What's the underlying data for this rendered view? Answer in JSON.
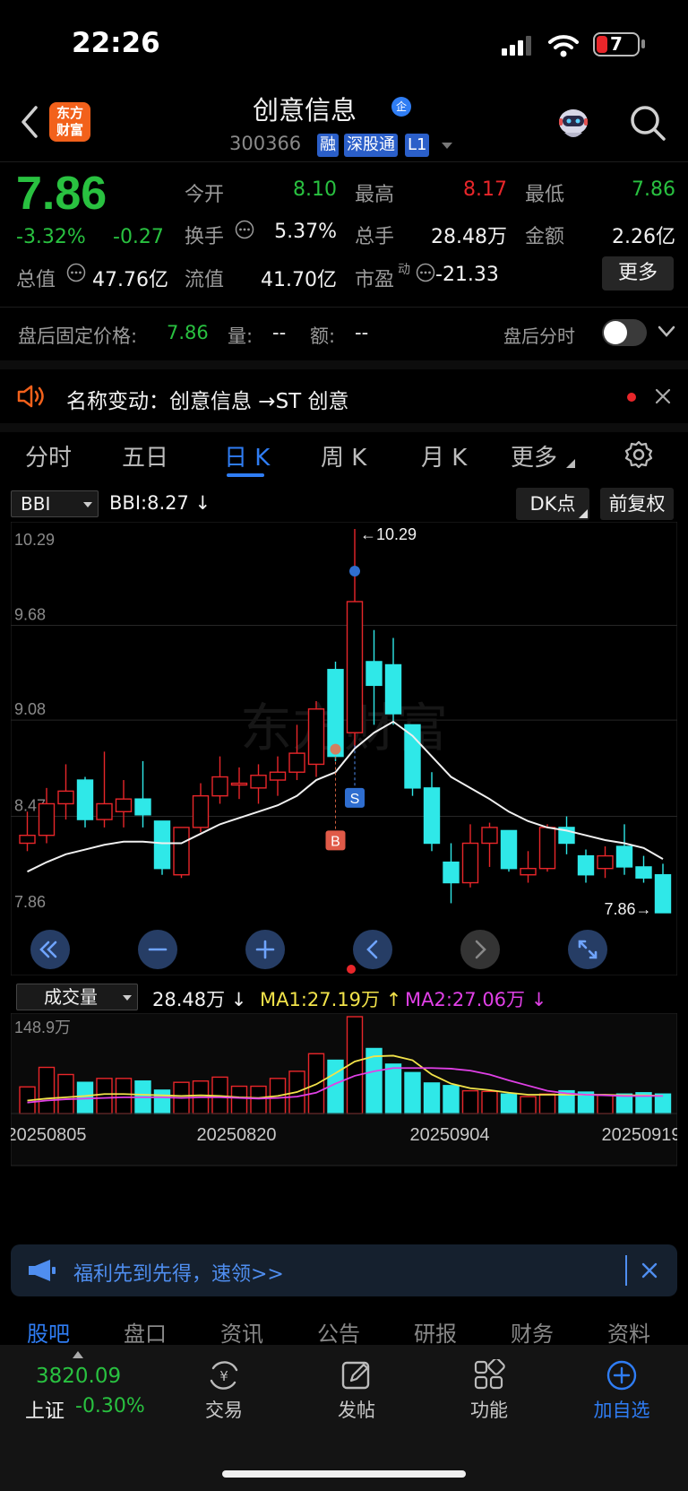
{
  "status_bar": {
    "time": "22:26",
    "battery": "7"
  },
  "header": {
    "logo_line1": "东方",
    "logo_line2": "财富",
    "name": "创意信息",
    "qi_badge": "企",
    "code": "300366",
    "tags": [
      "融",
      "深股通",
      "L1"
    ]
  },
  "quote": {
    "price": "7.86",
    "change_pct": "-3.32%",
    "change": "-0.27",
    "open_label": "今开",
    "open": "8.10",
    "high_label": "最高",
    "high": "8.17",
    "low_label": "最低",
    "low": "7.86",
    "turnover_label": "换手",
    "turnover": "5.37%",
    "volume_label": "总手",
    "volume": "28.48万",
    "amount_label": "金额",
    "amount": "2.26亿",
    "mcap_label": "总值",
    "mcap": "47.76亿",
    "float_label": "流值",
    "float_cap": "41.70亿",
    "pe_label": "市盈",
    "pe_sup": "动",
    "pe": "-21.33",
    "more": "更多"
  },
  "after_hours": {
    "label": "盘后固定价格:",
    "price": "7.86",
    "vol_label": "量:",
    "vol": "--",
    "amt_label": "额:",
    "amt": "--",
    "toggle_label": "盘后分时"
  },
  "notice": {
    "text": "名称变动：创意信息 →ST 创意"
  },
  "tabs": [
    "分时",
    "五日",
    "日 K",
    "周 K",
    "月 K",
    "更多"
  ],
  "chart_controls": {
    "indicator": "BBI",
    "indicator_value": "BBI:8.27",
    "dk": "DK点",
    "adjust": "前复权",
    "vol_indicator": "成交量",
    "vol_value": "28.48万",
    "ma1": "MA1:27.19万",
    "ma2": "MA2:27.06万"
  },
  "chart_data": [
    {
      "type": "candlestick",
      "y_ticks": [
        "10.29",
        "9.68",
        "9.08",
        "8.47",
        "7.86"
      ],
      "ylim": [
        7.86,
        10.29
      ],
      "max_label": "10.29",
      "min_label": "7.86",
      "markers": [
        "B",
        "S"
      ],
      "candles": [
        {
          "o": 8.3,
          "c": 8.35,
          "h": 8.5,
          "l": 8.25
        },
        {
          "o": 8.35,
          "c": 8.55,
          "h": 8.65,
          "l": 8.3
        },
        {
          "o": 8.55,
          "c": 8.63,
          "h": 8.8,
          "l": 8.45
        },
        {
          "o": 8.7,
          "c": 8.45,
          "h": 8.72,
          "l": 8.4
        },
        {
          "o": 8.45,
          "c": 8.55,
          "h": 8.88,
          "l": 8.4
        },
        {
          "o": 8.5,
          "c": 8.58,
          "h": 8.7,
          "l": 8.4
        },
        {
          "o": 8.58,
          "c": 8.48,
          "h": 8.82,
          "l": 8.4
        },
        {
          "o": 8.44,
          "c": 8.14,
          "h": 8.44,
          "l": 8.1
        },
        {
          "o": 8.1,
          "c": 8.4,
          "h": 8.4,
          "l": 8.08
        },
        {
          "o": 8.4,
          "c": 8.6,
          "h": 8.68,
          "l": 8.37
        },
        {
          "o": 8.6,
          "c": 8.72,
          "h": 8.85,
          "l": 8.55
        },
        {
          "o": 8.68,
          "c": 8.68,
          "h": 8.78,
          "l": 8.58
        },
        {
          "o": 8.65,
          "c": 8.73,
          "h": 8.8,
          "l": 8.55
        },
        {
          "o": 8.7,
          "c": 8.75,
          "h": 8.85,
          "l": 8.6
        },
        {
          "o": 8.75,
          "c": 8.87,
          "h": 9.05,
          "l": 8.7
        },
        {
          "o": 8.8,
          "c": 9.15,
          "h": 9.2,
          "l": 8.72
        },
        {
          "o": 9.4,
          "c": 8.85,
          "h": 9.45,
          "l": 8.82
        },
        {
          "o": 9.0,
          "c": 9.83,
          "h": 10.29,
          "l": 8.9
        },
        {
          "o": 9.45,
          "c": 9.3,
          "h": 9.65,
          "l": 9.05
        },
        {
          "o": 9.43,
          "c": 9.12,
          "h": 9.6,
          "l": 9.05
        },
        {
          "o": 9.05,
          "c": 8.65,
          "h": 9.05,
          "l": 8.6
        },
        {
          "o": 8.65,
          "c": 8.3,
          "h": 8.75,
          "l": 8.25
        },
        {
          "o": 8.18,
          "c": 8.05,
          "h": 8.3,
          "l": 7.92
        },
        {
          "o": 8.05,
          "c": 8.3,
          "h": 8.42,
          "l": 8.02
        },
        {
          "o": 8.3,
          "c": 8.4,
          "h": 8.43,
          "l": 8.15
        },
        {
          "o": 8.38,
          "c": 8.14,
          "h": 8.38,
          "l": 8.12
        },
        {
          "o": 8.1,
          "c": 8.14,
          "h": 8.25,
          "l": 8.05
        },
        {
          "o": 8.14,
          "c": 8.4,
          "h": 8.42,
          "l": 8.12
        },
        {
          "o": 8.4,
          "c": 8.3,
          "h": 8.47,
          "l": 8.23
        },
        {
          "o": 8.22,
          "c": 8.1,
          "h": 8.26,
          "l": 8.05
        },
        {
          "o": 8.14,
          "c": 8.22,
          "h": 8.28,
          "l": 8.08
        },
        {
          "o": 8.28,
          "c": 8.15,
          "h": 8.42,
          "l": 8.1
        },
        {
          "o": 8.15,
          "c": 8.08,
          "h": 8.22,
          "l": 8.05
        },
        {
          "o": 8.1,
          "c": 7.86,
          "h": 8.17,
          "l": 7.86
        }
      ],
      "bbi": [
        8.12,
        8.18,
        8.23,
        8.26,
        8.29,
        8.31,
        8.31,
        8.3,
        8.3,
        8.36,
        8.42,
        8.46,
        8.5,
        8.54,
        8.6,
        8.7,
        8.75,
        8.9,
        9.0,
        9.07,
        8.98,
        8.85,
        8.72,
        8.65,
        8.58,
        8.5,
        8.44,
        8.4,
        8.38,
        8.35,
        8.32,
        8.3,
        8.27,
        8.2
      ]
    },
    {
      "type": "bar",
      "name": "成交量",
      "y_top_label": "148.9万",
      "x_labels": [
        "20250805",
        "20250820",
        "20250904",
        "20250919"
      ],
      "values": [
        41,
        71,
        60,
        48,
        54,
        54,
        50,
        36,
        48,
        50,
        56,
        42,
        42,
        54,
        65,
        92,
        82,
        148.9,
        100,
        76,
        63,
        47,
        43,
        35,
        34,
        30,
        26,
        30,
        35,
        33,
        28,
        30,
        32,
        30
      ],
      "ma1": [
        20,
        23,
        25,
        27,
        30,
        30,
        29,
        28,
        27,
        28,
        27,
        25,
        24,
        27,
        33,
        45,
        62,
        80,
        88,
        89,
        82,
        60,
        46,
        39,
        36,
        32,
        29,
        29,
        29,
        29,
        29,
        28,
        28,
        27.19
      ],
      "ma2": [
        17,
        20,
        22,
        23,
        24,
        25,
        25,
        25,
        24,
        25,
        25,
        24,
        23,
        24,
        26,
        32,
        46,
        58,
        65,
        70,
        70,
        70,
        69,
        66,
        60,
        51,
        43,
        35,
        31,
        29,
        28,
        27,
        27,
        27.06
      ]
    }
  ],
  "promo": {
    "text": "福利先到先得，速领>>"
  },
  "sub_tabs": [
    "股吧",
    "盘口",
    "资讯",
    "公告",
    "研报",
    "财务",
    "资料"
  ],
  "bottom_nav": {
    "index_value": "3820.09",
    "index_name": "上证",
    "index_change": "-0.30%",
    "items": [
      "交易",
      "发帖",
      "功能",
      "加自选"
    ]
  }
}
